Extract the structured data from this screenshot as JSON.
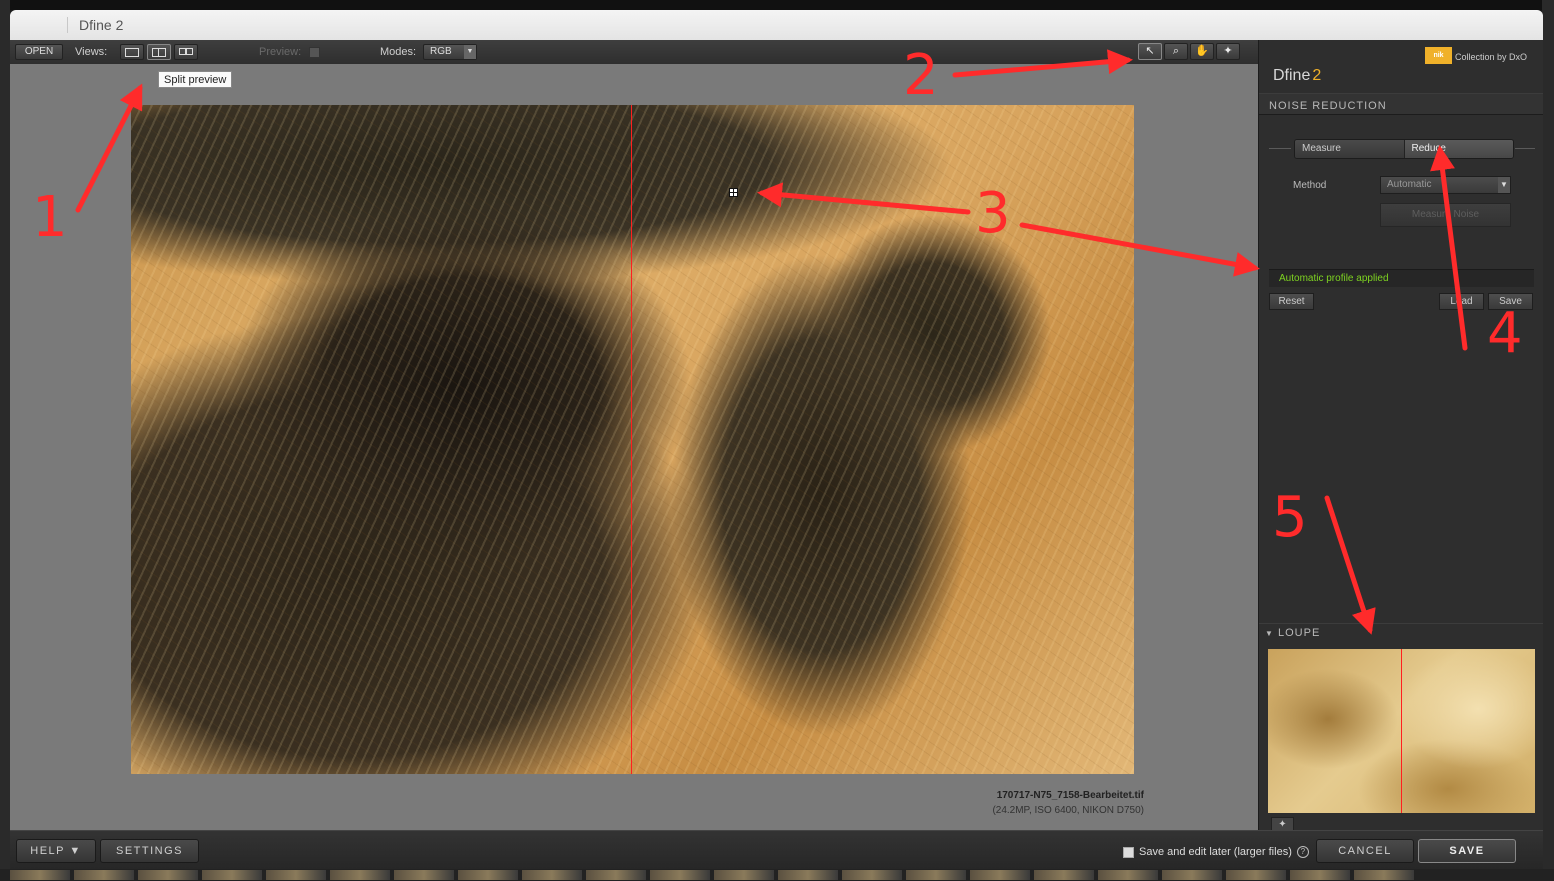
{
  "window": {
    "title": "Dfine 2"
  },
  "toolbar": {
    "open_label": "OPEN",
    "views_label": "Views:",
    "preview_label": "Preview:",
    "modes_label": "Modes:",
    "mode_value": "RGB",
    "tooltip": "Split preview",
    "tools": [
      "arrow-icon",
      "zoom-icon",
      "hand-icon",
      "color-picker-icon"
    ],
    "tool_glyphs": [
      "↖",
      "⌕",
      "✋",
      "✦"
    ]
  },
  "image": {
    "filename": "170717-N75_7158-Bearbeitet.tif",
    "meta": "(24.2MP, ISO 6400, NIKON D750)"
  },
  "panel": {
    "brand_logo": "nik",
    "brand_text": "Collection by DxO",
    "title": "Dfine",
    "title_num": "2",
    "section": "NOISE REDUCTION",
    "measure_tab": "Measure",
    "reduce_tab": "Reduce",
    "method_label": "Method",
    "method_value": "Automatic",
    "measure_noise": "Measure Noise",
    "status": "Automatic profile applied",
    "reset": "Reset",
    "load": "Load",
    "save": "Save",
    "loupe": "LOUPE"
  },
  "bottom": {
    "help": "HELP ▼",
    "settings": "SETTINGS",
    "save_later": "Save and edit later (larger files)",
    "cancel": "CANCEL",
    "save": "SAVE"
  },
  "annotations": [
    "1",
    "2",
    "3",
    "4",
    "5"
  ],
  "colors": {
    "accent": "#f0b12a",
    "status_green": "#7ed321",
    "annotation_red": "#ff2b2b",
    "split_line": "#ff1f1f"
  }
}
